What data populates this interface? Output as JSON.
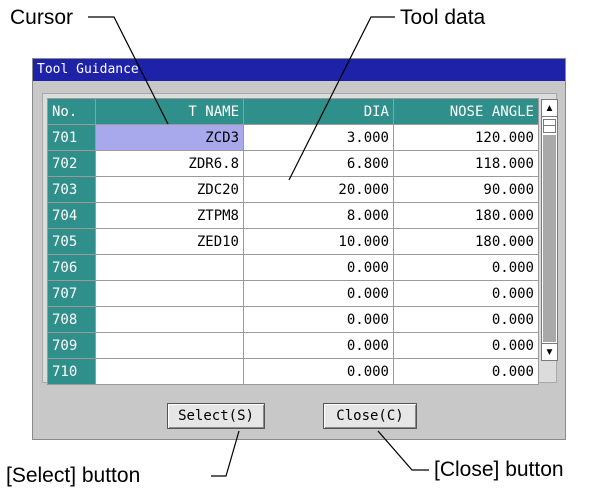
{
  "callouts": {
    "cursor": "Cursor",
    "tool_data": "Tool data",
    "select_button": "[Select] button",
    "close_button": "[Close] button"
  },
  "window": {
    "title": "Tool Guidance",
    "title_bar_color": "#1e22a8",
    "header_color": "#2f8f8a",
    "cursor_color": "#a8a8ec"
  },
  "table": {
    "columns": [
      "No.",
      "T NAME",
      "DIA",
      "NOSE ANGLE"
    ],
    "rows": [
      {
        "no": "701",
        "name": "ZCD3",
        "dia": "3.000",
        "nose": "120.000",
        "selected": true
      },
      {
        "no": "702",
        "name": "ZDR6.8",
        "dia": "6.800",
        "nose": "118.000"
      },
      {
        "no": "703",
        "name": "ZDC20",
        "dia": "20.000",
        "nose": "90.000"
      },
      {
        "no": "704",
        "name": "ZTPM8",
        "dia": "8.000",
        "nose": "180.000"
      },
      {
        "no": "705",
        "name": "ZED10",
        "dia": "10.000",
        "nose": "180.000"
      },
      {
        "no": "706",
        "name": "",
        "dia": "0.000",
        "nose": "0.000"
      },
      {
        "no": "707",
        "name": "",
        "dia": "0.000",
        "nose": "0.000"
      },
      {
        "no": "708",
        "name": "",
        "dia": "0.000",
        "nose": "0.000"
      },
      {
        "no": "709",
        "name": "",
        "dia": "0.000",
        "nose": "0.000"
      },
      {
        "no": "710",
        "name": "",
        "dia": "0.000",
        "nose": "0.000"
      }
    ]
  },
  "scrollbar": {
    "up_icon": "▲",
    "down_icon": "▼"
  },
  "buttons": {
    "select_label": "Select(S)",
    "close_label": "Close(C)"
  }
}
